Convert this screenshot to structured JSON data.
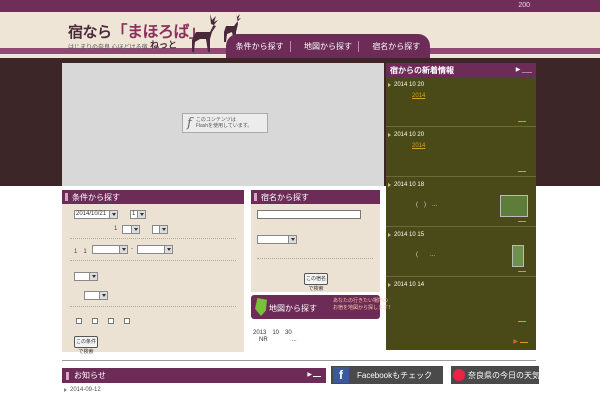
{
  "topbar": {
    "count": "200"
  },
  "logo": {
    "pre": "宿なら",
    "main": "「まほろば」",
    "net": "ねっと",
    "sub": "はじまりの奈良 心ほどける宿"
  },
  "nav": [
    {
      "label": "条件から探す"
    },
    {
      "label": "地図から探す"
    },
    {
      "label": "宿名から探す"
    }
  ],
  "flash": {
    "text1": "このコンテンツは",
    "text2": "Flashを使用しています。"
  },
  "news": {
    "title": "宿からの新着情報",
    "more": "▶ ___",
    "items": [
      {
        "date": "2014 10 20",
        "sub": "2014"
      },
      {
        "date": "2014 10 20",
        "sub": "2014"
      },
      {
        "date": "2014 10 18",
        "text": "(　)　..."
      },
      {
        "date": "2014 10 15",
        "text": "(　　..."
      },
      {
        "date": "2014 10 14",
        "text": ""
      }
    ],
    "footer_arrow": "▶"
  },
  "cond": {
    "title": "条件から探す",
    "date": "2014/10/21",
    "nights": "1",
    "rooms_label": "1",
    "guests_label": "1　1",
    "sep": "-",
    "button": "この条件で検索"
  },
  "namesearch": {
    "title": "宿名から探す",
    "button": "この宿名で検索"
  },
  "mapsearch": {
    "label": "地図から探す",
    "desc1": "あなたの行きたい場所の",
    "desc2": "お宿を地図から探します！"
  },
  "event": {
    "date": "2013　10　30",
    "text": "NR　　　　..."
  },
  "notice": {
    "title": "お知らせ",
    "arrow": "▶",
    "item": "2014-09-12"
  },
  "facebook": {
    "label": "Facebookもチェック",
    "icon": "f"
  },
  "weather": {
    "label": "奈良県の今日の天気"
  },
  "colors": {
    "brand": "#6d2c57",
    "header_bg": "#efe5d7",
    "dark_band": "#3d2628",
    "news_bg": "#4a4a18",
    "panel_bg": "#ece2d4"
  }
}
